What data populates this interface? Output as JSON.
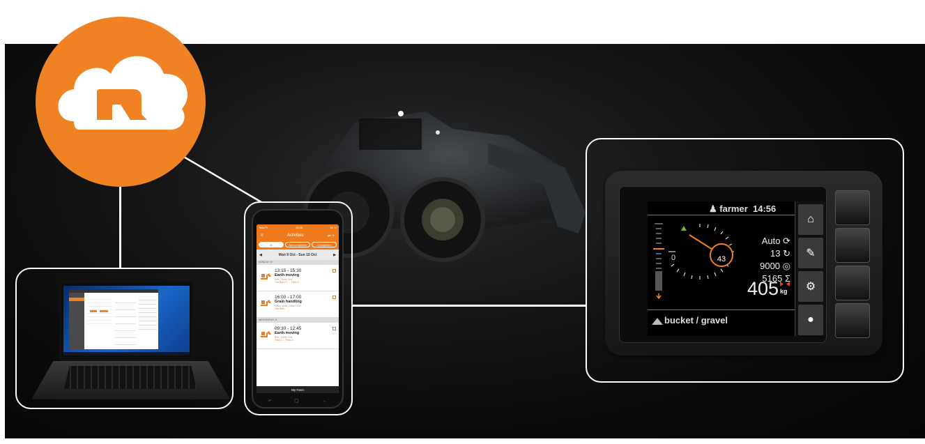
{
  "colors": {
    "brand_orange": "#f08224",
    "background": "#0a0a0a",
    "frame": "#ffffff"
  },
  "cloud_badge": {
    "icon": "cloud-logo-icon"
  },
  "laptop": {
    "icon": "laptop-icon"
  },
  "phone": {
    "status": {
      "carrier": "Telia FI",
      "time": "13:38",
      "battery": "61 %"
    },
    "title": "Activities",
    "tabs": [
      {
        "label": "All",
        "selected": true
      },
      {
        "label": "Not completed",
        "selected": false
      },
      {
        "label": "Completed",
        "selected": false
      }
    ],
    "week_range": "Mon 9 Oct - Sun 15 Oct",
    "days": [
      {
        "label": "MONDAY 09",
        "items": [
          {
            "time": "13:15 - 15:30",
            "title": "Earth moving",
            "detail": "Bob | Silver One",
            "location": "The Barn FI",
            "target": "Field 3"
          },
          {
            "time": "16:00 - 17:00",
            "title": "Grain handling",
            "detail": "Mikko Mutti | Silver One",
            "location": "The Barn",
            "target": ""
          }
        ]
      },
      {
        "label": "WEDNESDAY 11",
        "items": [
          {
            "time": "09:30 - 12:45",
            "title": "Earth moving",
            "detail": "Bob | Silver One",
            "location": "Field 1",
            "target": "Field 3"
          }
        ]
      }
    ],
    "bottom_bar": "My Farm"
  },
  "terminal": {
    "user": "farmer",
    "time": "14:56",
    "mode": "Auto",
    "count": "13",
    "target": "9000",
    "total": "5165",
    "sigma": "Σ",
    "weight": "405",
    "unit": "kg",
    "zero": "0",
    "angle": "43",
    "tool": "bucket / gravel",
    "side_icons": [
      "home-icon",
      "wrench-icon",
      "tools-icon",
      "circle-icon"
    ]
  }
}
